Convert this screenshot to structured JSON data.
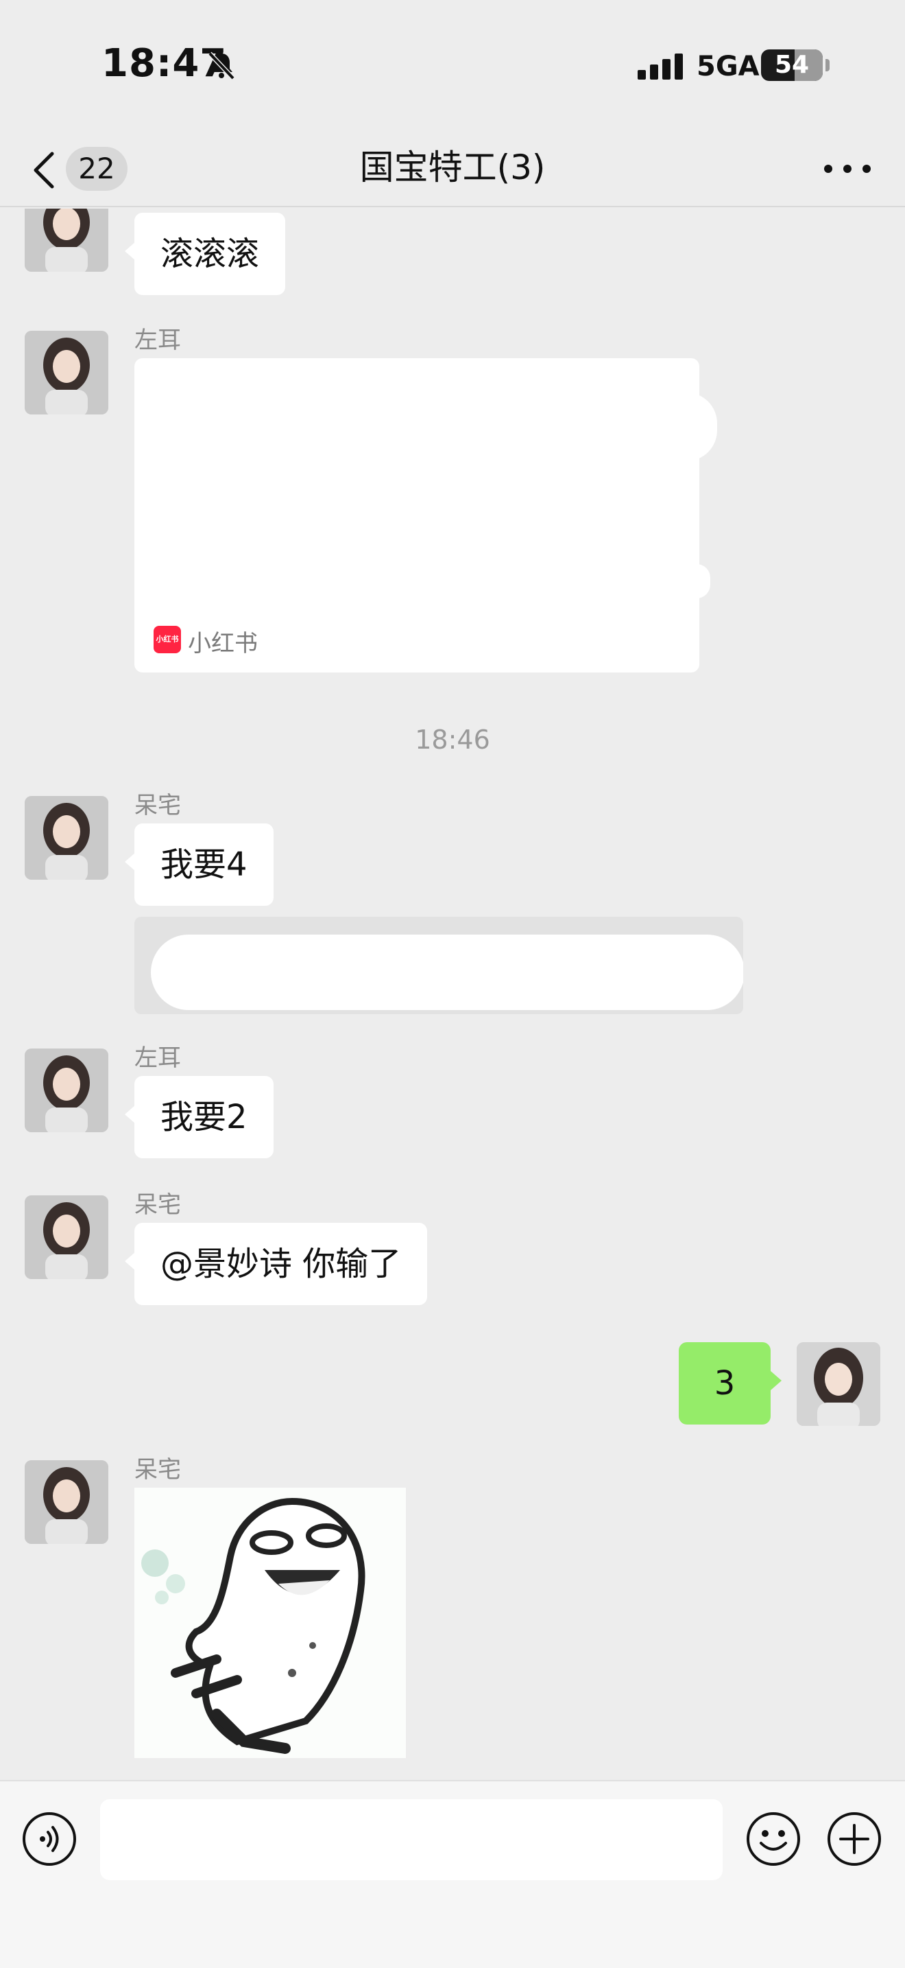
{
  "status_bar": {
    "time": "18:47",
    "network": "5GA",
    "battery_level": "54",
    "battery_fraction": 0.54
  },
  "nav": {
    "unread_count": "22",
    "title": "国宝特工(3)"
  },
  "messages": [
    {
      "sender": "",
      "text": "滚滚滚"
    },
    {
      "sender": "左耳",
      "card_source": "小红书"
    },
    {
      "timestamp": "18:46"
    },
    {
      "sender": "呆宅",
      "text": "我要4"
    },
    {
      "sender": "左耳",
      "text": "我要2"
    },
    {
      "sender": "呆宅",
      "text": "@景妙诗 你输了"
    },
    {
      "sender": "me",
      "text": "3"
    },
    {
      "sender": "呆宅",
      "sticker": "laughing-blob-sticker"
    }
  ],
  "icons": {
    "back": "chevron-left-icon",
    "more": "more-dots-icon",
    "voice": "voice-icon",
    "emoji": "emoji-icon",
    "plus": "plus-icon",
    "mute": "bell-mute-icon",
    "signal": "signal-icon",
    "card_source": "xiaohongshu-icon"
  },
  "colors": {
    "background": "#ededed",
    "my_bubble": "#95ec69",
    "their_bubble": "#ffffff",
    "xiaohongshu": "#ff2442"
  }
}
